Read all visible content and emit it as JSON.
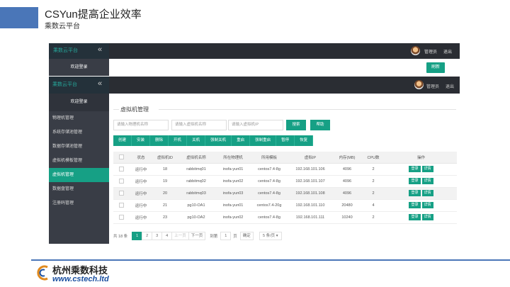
{
  "slide": {
    "title": "CSYun提高企业效率",
    "subtitle": "乘数云平台",
    "footer_cn": "杭州乘数科技",
    "footer_en": "www.cstech.ltd",
    "accent_color": "#4a76b8"
  },
  "back_window": {
    "brand": "乘数云平台",
    "collapse_icon": "«",
    "user": "管理员",
    "logout": "退出",
    "home": "欢迎登录",
    "refresh": "刷新"
  },
  "app": {
    "brand": "乘数云平台",
    "collapse_icon": "«",
    "user": "管理员",
    "logout": "退出",
    "accent_color": "#16a085",
    "sidebar": {
      "home": "欢迎登录",
      "items": [
        "物理机管理",
        "系统存储池管理",
        "数据存储池管理",
        "虚拟机模板管理",
        "虚拟机管理",
        "数据盘管理",
        "注册码管理"
      ],
      "active_index": 4
    },
    "page_title": "虚拟机管理",
    "search": {
      "host_placeholder": "请输入物理机名称",
      "vm_placeholder": "请输入虚拟机名称",
      "ip_placeholder": "请输入虚拟机IP",
      "search_btn": "搜索",
      "help_btn": "帮助"
    },
    "toolbar": [
      "创建",
      "安装",
      "删除",
      "开机",
      "关机",
      "强制关机",
      "重启",
      "强制重启",
      "暂停",
      "恢复"
    ],
    "table": {
      "headers": [
        "状态",
        "虚拟机ID",
        "虚拟机名称",
        "所在物理机",
        "所用模板",
        "虚拟IP",
        "内存(MB)",
        "CPU数",
        "操作"
      ],
      "rows": [
        [
          "运行中",
          "18",
          "rabbitmq01",
          "inofa-yun01",
          "centos7.4-8g",
          "192.168.101.106",
          "4096",
          "2"
        ],
        [
          "运行中",
          "19",
          "rabbitmq02",
          "inofa-yun02",
          "centos7.4-8g",
          "192.168.101.107",
          "4096",
          "2"
        ],
        [
          "运行中",
          "20",
          "rabbitmq03",
          "inofa-yun03",
          "centos7.4-8g",
          "192.168.101.108",
          "4096",
          "2"
        ],
        [
          "运行中",
          "21",
          "pg10-OA1",
          "inofa-yun01",
          "centos7.4-20g",
          "192.168.101.110",
          "20480",
          "4"
        ],
        [
          "运行中",
          "23",
          "pg10-OA2",
          "inofa-yun02",
          "centos7.4-8g",
          "192.168.101.111",
          "10240",
          "2"
        ]
      ],
      "op_login": "登录",
      "op_detail": "详情"
    },
    "pager": {
      "total": "共 18 条",
      "pages": [
        "1",
        "2",
        "3",
        "4"
      ],
      "prev": "上一页",
      "next": "下一页",
      "goto": "到第",
      "goto_value": "1",
      "page_unit": "页",
      "confirm": "确定",
      "per_page": "5 条/页"
    }
  }
}
